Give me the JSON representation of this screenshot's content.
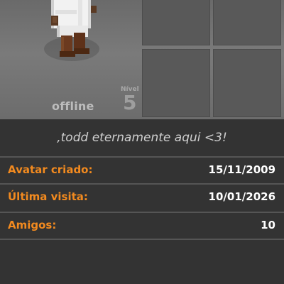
{
  "profile": {
    "status": "offline",
    "level_label": "Nível",
    "level": "5",
    "motto": ",todd eternamente aqui <3!"
  },
  "info_rows": [
    {
      "label": "Avatar criado:",
      "value": "15/11/2009"
    },
    {
      "label": "Última visita:",
      "value": "10/01/2026"
    },
    {
      "label": "Amigos:",
      "value": "10"
    }
  ],
  "colors": {
    "label_orange": "#f28a1f",
    "value_white": "#ffffff",
    "panel_dark": "#333333"
  }
}
